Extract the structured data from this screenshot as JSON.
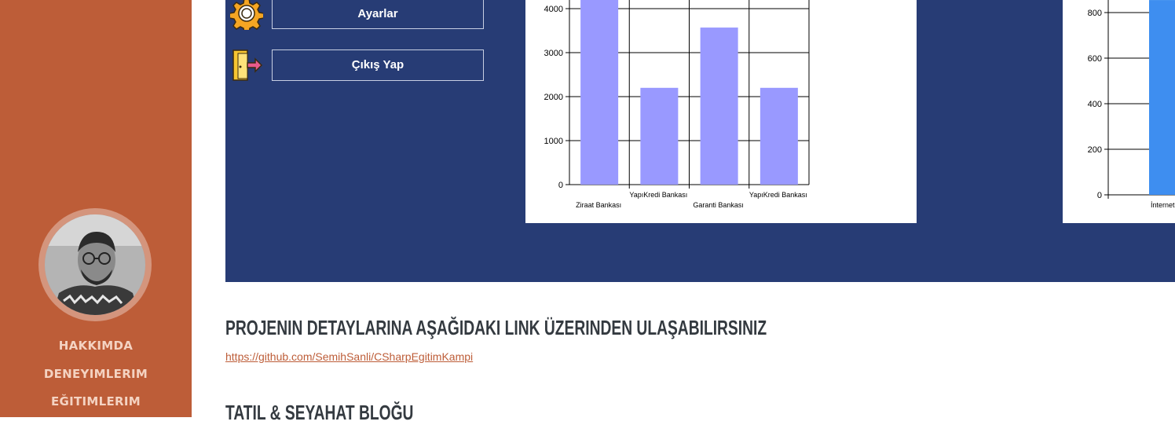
{
  "sidebar": {
    "nav": [
      {
        "label": "HAKKIMDA"
      },
      {
        "label": "DENEYIMLERIM"
      },
      {
        "label": "EĞITIMLERIM"
      }
    ]
  },
  "screenshot": {
    "buttons": [
      {
        "label": "Ayarlar",
        "icon": "gear-icon"
      },
      {
        "label": "Çıkış Yap",
        "icon": "exit-door-icon"
      }
    ]
  },
  "chart_data": [
    {
      "type": "bar",
      "categories": [
        "Ziraat Bankası",
        "YapıKredi Bankası",
        "Garanti Bankası",
        "YapıKredi Bankası"
      ],
      "values": [
        4350,
        2200,
        3570,
        2200
      ],
      "yticks": [
        "4000",
        "3000",
        "2000",
        "1000",
        "0"
      ],
      "ylim": [
        0,
        4400
      ],
      "grid": true,
      "color": "#9999ff"
    },
    {
      "type": "bar",
      "categories": [
        "İnternet"
      ],
      "values": [
        855
      ],
      "yticks": [
        "800",
        "600",
        "400",
        "200",
        "0"
      ],
      "ylim": [
        0,
        900
      ],
      "grid": true,
      "color": "#3e8ef0"
    }
  ],
  "content": {
    "heading": "PROJENIN DETAYLARINA AŞAĞIDAKI LINK ÜZERINDEN ULAŞABILIRSINIZ",
    "link": "https://github.com/SemihSanli/CSharpEgitimKampi",
    "heading2": "TATIL & SEYAHAT BLOĞU"
  },
  "colors": {
    "sidebar": "#bd5d38",
    "app_bg": "#273c75",
    "link": "#bd5d38"
  }
}
